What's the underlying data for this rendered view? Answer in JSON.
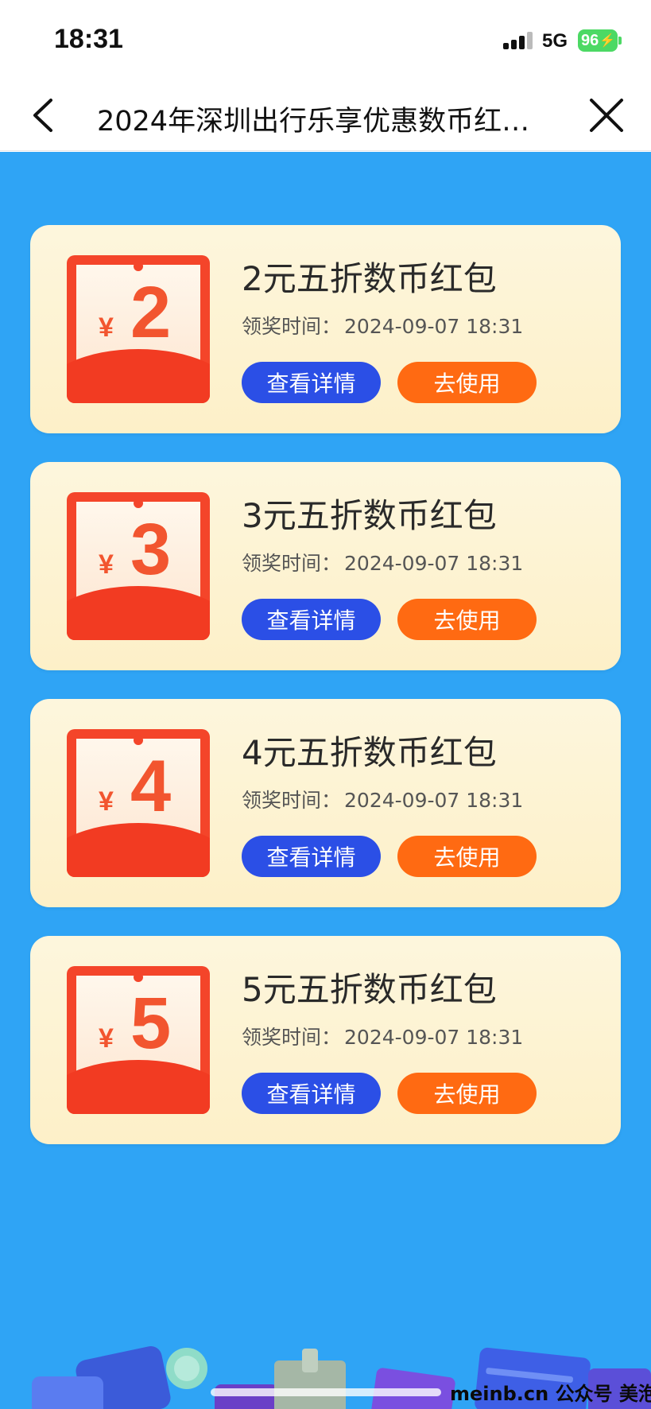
{
  "status_bar": {
    "time": "18:31",
    "network": "5G",
    "battery": "96",
    "battery_charging": true
  },
  "nav": {
    "title": "2024年深圳出行乐享优惠数币红…",
    "back_icon": "chevron-left-icon",
    "close_icon": "close-icon"
  },
  "colors": {
    "background": "#2fa4f5",
    "card": "#fdf3d2",
    "envelope": "#f4452a",
    "detail_button": "#2b4fe6",
    "use_button": "#ff6a12"
  },
  "cards": [
    {
      "amount": "2",
      "currency": "¥",
      "title": "2元五折数币红包",
      "time_label": "领奖时间：",
      "time_value": "2024-09-07 18:31",
      "detail_label": "查看详情",
      "use_label": "去使用"
    },
    {
      "amount": "3",
      "currency": "¥",
      "title": "3元五折数币红包",
      "time_label": "领奖时间：",
      "time_value": "2024-09-07 18:31",
      "detail_label": "查看详情",
      "use_label": "去使用"
    },
    {
      "amount": "4",
      "currency": "¥",
      "title": "4元五折数币红包",
      "time_label": "领奖时间：",
      "time_value": "2024-09-07 18:31",
      "detail_label": "查看详情",
      "use_label": "去使用"
    },
    {
      "amount": "5",
      "currency": "¥",
      "title": "5元五折数币红包",
      "time_label": "领奖时间：",
      "time_value": "2024-09-07 18:31",
      "detail_label": "查看详情",
      "use_label": "去使用"
    }
  ],
  "watermark": "meinb.cn 公众号 美泡君"
}
